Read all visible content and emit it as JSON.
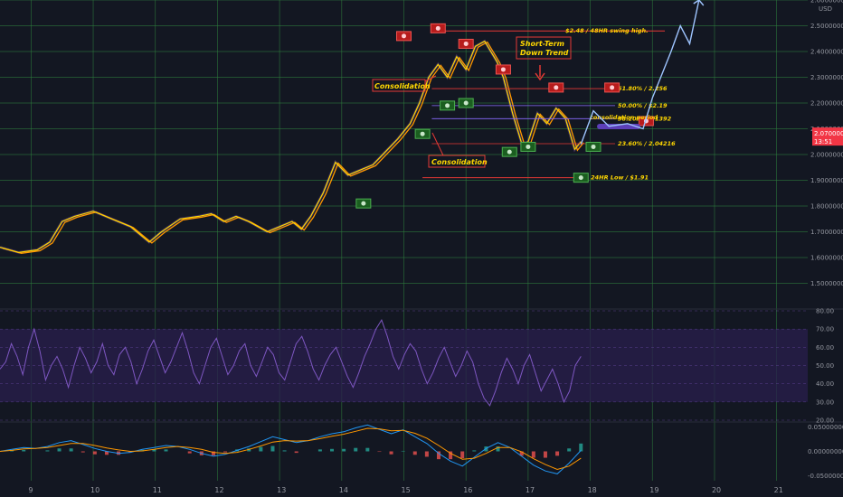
{
  "chart_data": [
    {
      "type": "candlestick",
      "pair_unit": "USD",
      "y_ticks": [
        "2.60000000",
        "2.50000000",
        "2.40000000",
        "2.30000000",
        "2.20000000",
        "2.10000000",
        "2.00000000",
        "1.90000000",
        "1.80000000",
        "1.70000000",
        "1.60000000",
        "1.50000000"
      ],
      "ylim": [
        1.4,
        2.6
      ],
      "x_ticks": [
        "9",
        "10",
        "11",
        "12",
        "13",
        "14",
        "15",
        "16",
        "17",
        "18",
        "19",
        "20",
        "21"
      ],
      "xlim": [
        8.5,
        21.5
      ],
      "current_price_label": "2.07000000",
      "current_price": 2.07,
      "countdown": "13:51",
      "price_path_x": [
        8.5,
        8.8,
        9.1,
        9.3,
        9.5,
        9.7,
        10.0,
        10.3,
        10.6,
        10.9,
        11.1,
        11.4,
        11.7,
        11.9,
        12.1,
        12.3,
        12.5,
        12.8,
        13.0,
        13.2,
        13.35,
        13.5,
        13.7,
        13.9,
        14.1,
        14.3,
        14.5,
        14.7,
        14.9,
        15.1,
        15.25,
        15.4,
        15.55,
        15.7,
        15.85,
        16.0,
        16.15,
        16.3,
        16.5,
        16.6,
        16.75,
        16.9,
        17.0,
        17.15,
        17.3,
        17.45,
        17.6,
        17.75,
        17.85
      ],
      "price_path_y": [
        1.64,
        1.62,
        1.63,
        1.66,
        1.74,
        1.76,
        1.78,
        1.75,
        1.72,
        1.66,
        1.7,
        1.75,
        1.76,
        1.77,
        1.74,
        1.76,
        1.74,
        1.7,
        1.72,
        1.74,
        1.71,
        1.76,
        1.85,
        1.97,
        1.92,
        1.94,
        1.96,
        2.01,
        2.06,
        2.12,
        2.2,
        2.3,
        2.35,
        2.3,
        2.38,
        2.33,
        2.42,
        2.44,
        2.36,
        2.3,
        2.16,
        2.04,
        2.05,
        2.16,
        2.12,
        2.18,
        2.14,
        2.02,
        2.05
      ],
      "fib_levels": [
        {
          "label": "61.80% / 2.256",
          "value": 2.256
        },
        {
          "label": "50.00% / $2.19",
          "value": 2.19
        },
        {
          "label": "38.20% / 2.1392",
          "value": 2.1392
        },
        {
          "label": "23.60% / 2.04216",
          "value": 2.04216
        }
      ],
      "swing_high": {
        "label": "$2.48 / 48HR swing high.",
        "value": 2.48
      },
      "swing_low": {
        "label": "24HR Low / $1.91",
        "value": 1.91
      },
      "annotations": {
        "short_term": [
          "Short-Term",
          "Down Trend"
        ],
        "consolidation_1": "Consolidation",
        "consolidation_2": "Consolidation",
        "consolidation_period": "consolidation period"
      },
      "projection_x": [
        17.85,
        18.05,
        18.3,
        18.6,
        18.85,
        19.0,
        19.15,
        19.3,
        19.45,
        19.6,
        19.75
      ],
      "projection_y": [
        2.04,
        2.17,
        2.11,
        2.12,
        2.1,
        2.22,
        2.31,
        2.4,
        2.5,
        2.43,
        2.6
      ],
      "buy_markers_x": [
        14.35,
        15.3,
        15.7,
        16.0,
        16.7,
        17.0,
        17.85,
        18.05
      ],
      "buy_markers_y": [
        1.81,
        2.08,
        2.19,
        2.2,
        2.01,
        2.03,
        1.91,
        2.03
      ],
      "sell_markers_x": [
        15.0,
        15.55,
        16.0,
        16.6,
        17.45,
        18.35,
        18.9
      ],
      "sell_markers_y": [
        2.46,
        2.49,
        2.43,
        2.33,
        2.26,
        2.26,
        2.13
      ],
      "colors": {
        "background": "#131722",
        "grid": "#2d7a3c",
        "price_line": "#ffd700",
        "ma": "#ff9800",
        "fib": "#ffffff",
        "swing": "#e53935",
        "projection": "#9ec4ff",
        "price_tag": "#f23645"
      }
    },
    {
      "type": "line",
      "name": "rsi",
      "y_ticks": [
        "80.00",
        "70.00",
        "60.00",
        "50.00",
        "40.00",
        "30.00",
        "20.00"
      ],
      "ylim": [
        20,
        80
      ],
      "band": [
        30,
        70
      ],
      "values": [
        48,
        52,
        62,
        55,
        45,
        60,
        70,
        58,
        42,
        50,
        55,
        48,
        38,
        50,
        60,
        54,
        46,
        52,
        62,
        50,
        45,
        56,
        60,
        52,
        40,
        48,
        58,
        64,
        55,
        46,
        52,
        60,
        68,
        58,
        46,
        40,
        50,
        60,
        65,
        55,
        45,
        50,
        58,
        62,
        50,
        44,
        52,
        60,
        56,
        46,
        42,
        52,
        62,
        66,
        58,
        48,
        42,
        50,
        56,
        60,
        52,
        44,
        38,
        46,
        55,
        62,
        70,
        75,
        66,
        55,
        48,
        56,
        62,
        58,
        48,
        40,
        46,
        54,
        60,
        52,
        44,
        50,
        58,
        52,
        40,
        32,
        28,
        36,
        46,
        54,
        48,
        40,
        50,
        56,
        46,
        36,
        42,
        48,
        40,
        30,
        36,
        50,
        55
      ],
      "colors": {
        "line": "#7e57c2",
        "band_fill": "#2a1f4d"
      }
    },
    {
      "type": "line",
      "name": "macd",
      "y_ticks": [
        "0.05000000",
        "0.00000000",
        "-0.05000000"
      ],
      "ylim": [
        -0.06,
        0.06
      ],
      "macd": [
        0,
        0.004,
        0.008,
        0.006,
        0.01,
        0.018,
        0.022,
        0.014,
        0.006,
        0,
        -0.004,
        -0.002,
        0.004,
        0.008,
        0.012,
        0.01,
        0.004,
        -0.004,
        -0.01,
        -0.006,
        0.002,
        0.01,
        0.02,
        0.03,
        0.024,
        0.018,
        0.022,
        0.03,
        0.036,
        0.04,
        0.048,
        0.054,
        0.045,
        0.036,
        0.044,
        0.03,
        0.016,
        -0.004,
        -0.02,
        -0.03,
        -0.012,
        0.006,
        0.018,
        0.008,
        -0.01,
        -0.028,
        -0.04,
        -0.046,
        -0.024,
        0.002
      ],
      "signal": [
        0,
        0.002,
        0.005,
        0.006,
        0.008,
        0.012,
        0.016,
        0.016,
        0.012,
        0.007,
        0.003,
        0,
        0.001,
        0.004,
        0.008,
        0.01,
        0.008,
        0.004,
        -0.002,
        -0.004,
        -0.002,
        0.004,
        0.011,
        0.019,
        0.022,
        0.021,
        0.022,
        0.026,
        0.031,
        0.035,
        0.041,
        0.047,
        0.046,
        0.042,
        0.043,
        0.037,
        0.027,
        0.012,
        -0.004,
        -0.016,
        -0.014,
        -0.004,
        0.008,
        0.008,
        -0.001,
        -0.015,
        -0.027,
        -0.037,
        -0.03,
        -0.014
      ],
      "colors": {
        "macd": "#2196f3",
        "signal": "#ff9800",
        "hist_up": "#26a69a",
        "hist_down": "#ef5350"
      }
    }
  ]
}
